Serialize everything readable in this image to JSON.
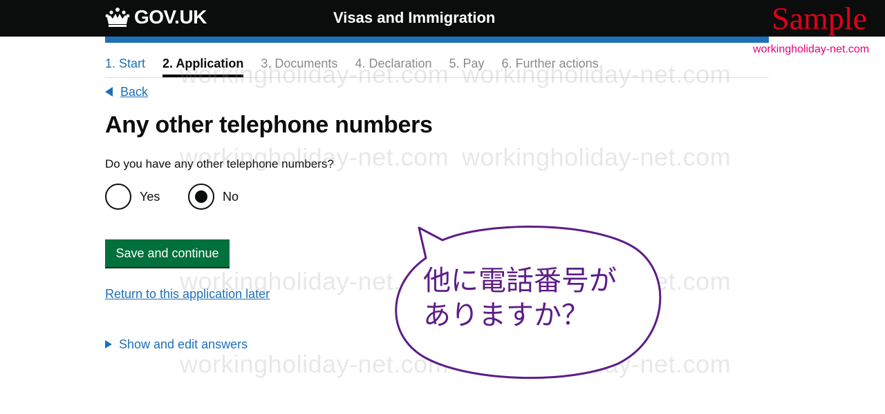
{
  "header": {
    "logo_text": "GOV.UK",
    "service_name": "Visas and Immigration"
  },
  "overlay": {
    "sample_tag": "Sample",
    "site_tag": "workingholiday-net.com",
    "watermark_text": "workingholiday-net.com"
  },
  "steps": [
    {
      "label": "1. Start",
      "state": "completed"
    },
    {
      "label": "2. Application",
      "state": "current"
    },
    {
      "label": "3. Documents",
      "state": "future"
    },
    {
      "label": "4. Declaration",
      "state": "future"
    },
    {
      "label": "5. Pay",
      "state": "future"
    },
    {
      "label": "6. Further actions",
      "state": "future"
    }
  ],
  "back_link": "Back",
  "page_title": "Any other telephone numbers",
  "question": "Do you have any other telephone numbers?",
  "options": [
    {
      "label": "Yes",
      "checked": false
    },
    {
      "label": "No",
      "checked": true
    }
  ],
  "save_button": "Save and continue",
  "return_link": "Return to this application later",
  "details_summary": "Show and edit answers",
  "annotation": {
    "line1": "他に電話番号が",
    "line2": "ありますか？"
  },
  "colors": {
    "header_bg": "#0b0c0c",
    "brand_blue": "#1d70b8",
    "button_green": "#00703c",
    "annotation_purple": "#5c1d87",
    "sample_red": "#e0001b"
  }
}
